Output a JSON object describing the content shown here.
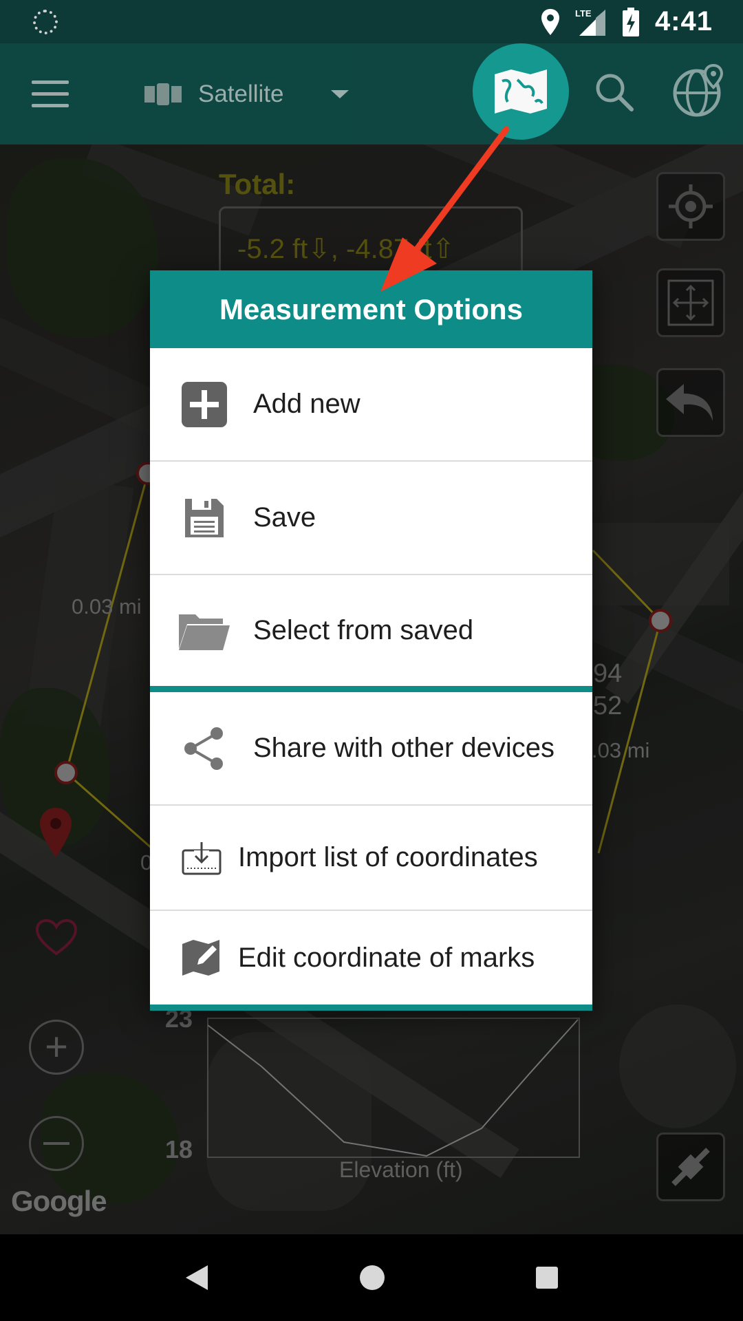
{
  "status_bar": {
    "time": "4:41",
    "network": "LTE",
    "icons": [
      "loading-icon",
      "location-icon",
      "lte-signal-icon",
      "battery-charging-icon"
    ]
  },
  "toolbar": {
    "map_layer": "Satellite",
    "icons": [
      "menu-icon",
      "satellite-icon",
      "dropdown-caret-icon",
      "map-measure-icon",
      "search-icon",
      "globe-location-icon"
    ]
  },
  "map": {
    "total_label": "Total:",
    "total_value": "-5.2 ft⇩, -4.87 ft⇧",
    "distance_labels": [
      "0.03 mi",
      "94",
      "52",
      ".03 mi",
      "0"
    ],
    "attribution": "Google"
  },
  "dialog": {
    "title": "Measurement Options",
    "options": [
      {
        "label": "Add new",
        "icon": "add-box-icon"
      },
      {
        "label": "Save",
        "icon": "save-icon"
      },
      {
        "label": "Select from saved",
        "icon": "folder-icon"
      },
      {
        "label": "Share with other devices",
        "icon": "share-icon"
      },
      {
        "label": "Import list of coordinates",
        "icon": "import-icon"
      },
      {
        "label": "Edit coordinate of marks",
        "icon": "edit-map-icon"
      }
    ]
  },
  "elevation_chart": {
    "y_max": "23",
    "y_min": "18",
    "x_label": "Elevation  (ft)"
  },
  "colors": {
    "toolbar": "#0e4743",
    "accent": "#0e8c87",
    "measure_button": "#149c94",
    "arrow": "#ee3b22"
  }
}
